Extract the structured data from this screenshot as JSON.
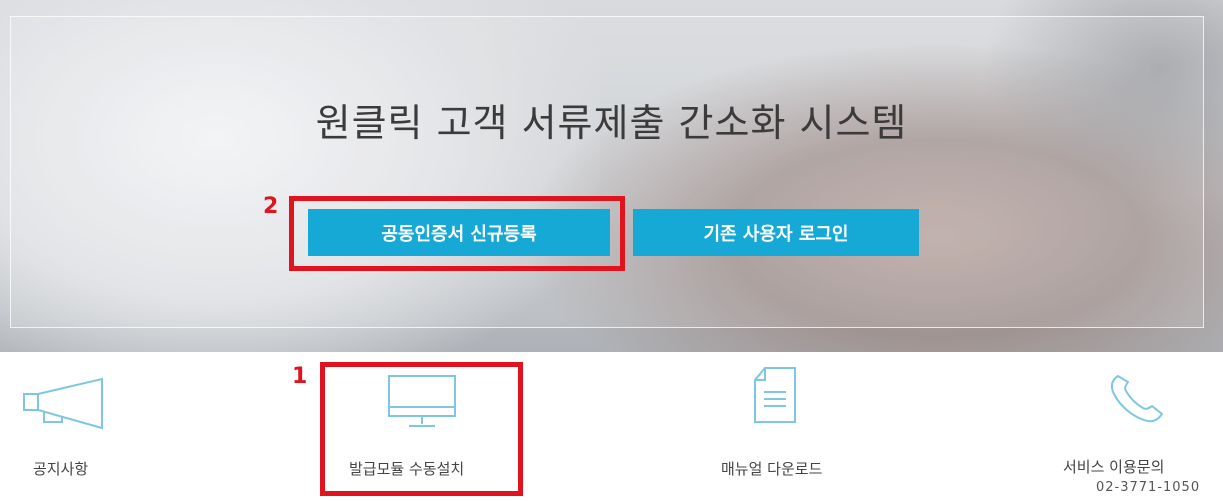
{
  "hero": {
    "title": "원클릭 고객 서류제출 간소화 시스템",
    "register_button": "공동인증서 신규등록",
    "login_button": "기존 사용자 로그인",
    "callout_register": "2"
  },
  "quick_links": {
    "callout_install": "1",
    "items": [
      {
        "label": "공지사항",
        "icon": "megaphone-icon"
      },
      {
        "label": "발급모듈 수동설치",
        "icon": "monitor-icon"
      },
      {
        "label": "매뉴얼 다운로드",
        "icon": "document-icon"
      },
      {
        "label": "서비스 이용문의",
        "icon": "phone-icon",
        "phone": "02-3771-1050"
      }
    ]
  },
  "colors": {
    "accent": "#17a9d6",
    "callout": "#e0141e",
    "icon_stroke": "#7fc6e0"
  }
}
